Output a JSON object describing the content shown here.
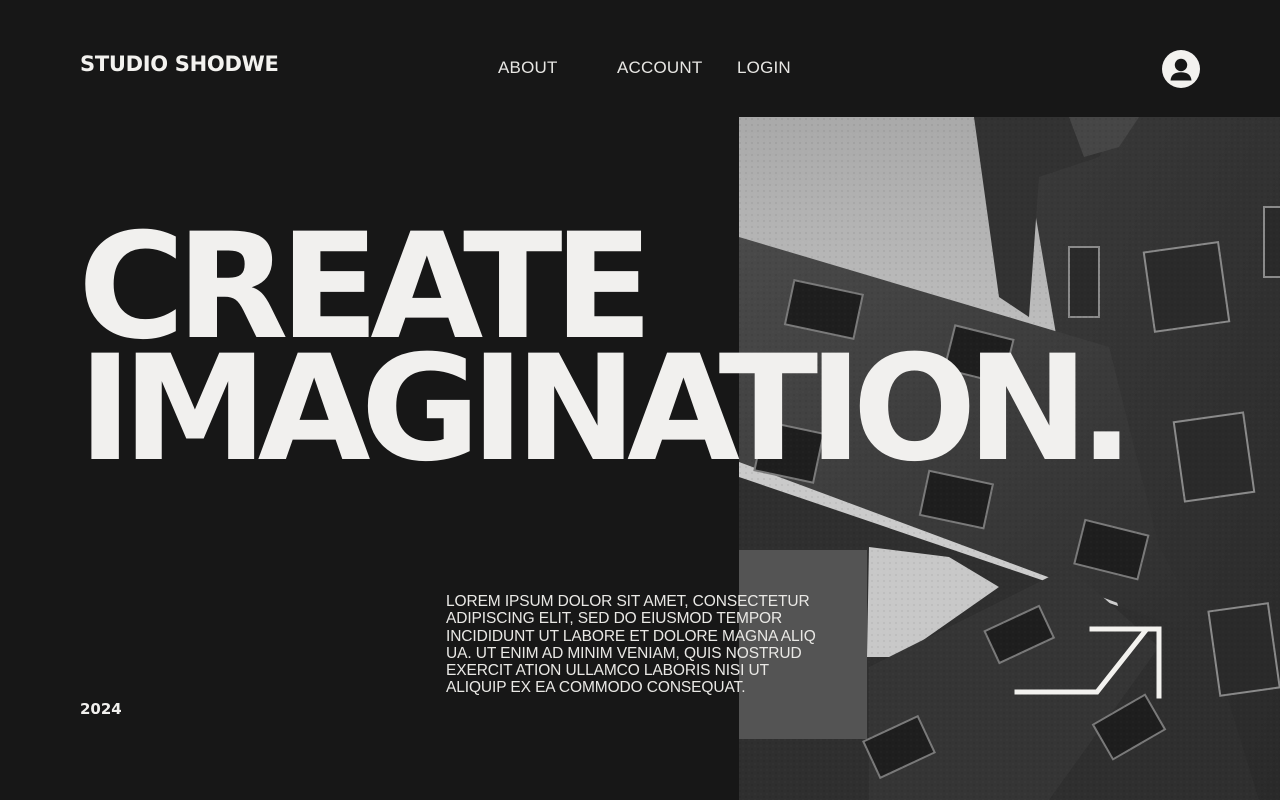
{
  "header": {
    "brand": "STUDIO SHODWE",
    "nav": {
      "about": "ABOUT",
      "account": "ACCOUNT",
      "login": "LOGIN"
    },
    "avatar_icon": "user-icon"
  },
  "hero": {
    "headline_line1": "CREATE",
    "headline_line2": "IMAGINATION.",
    "body": "LOREM IPSUM DOLOR SIT AMET, CONSECTETUR\nADIPISCING ELIT, SED DO EIUSMOD TEMPOR\nINCIDIDUNT UT LABORE ET DOLORE MAGNA ALIQ\nUA. UT ENIM AD MINIM VENIAM, QUIS NOSTRUD\nEXERCIT ATION ULLAMCO LABORIS NISI UT\nALIQUIP EX EA COMMODO CONSEQUAT.",
    "year": "2024",
    "arrow_icon": "arrow-up-right-icon"
  },
  "colors": {
    "background": "#171717",
    "text": "#f1f0ee",
    "overlay": "#5f5f5f"
  }
}
